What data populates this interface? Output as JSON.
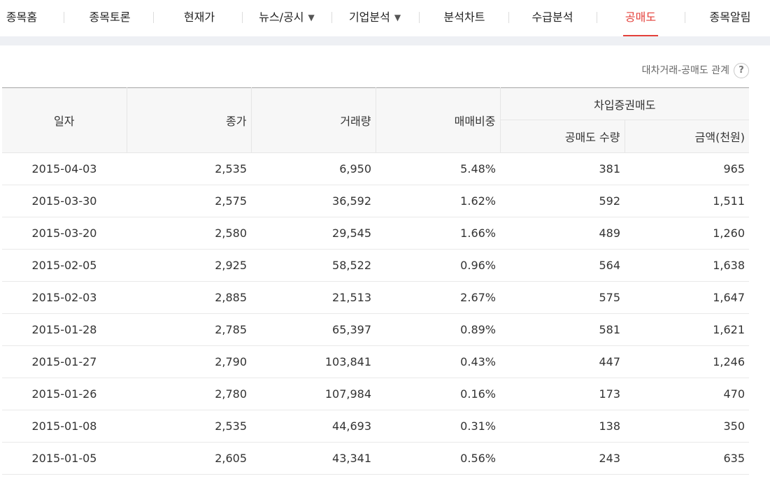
{
  "tabs": [
    {
      "label": "종목홈"
    },
    {
      "label": "종목토론"
    },
    {
      "label": "현재가"
    },
    {
      "label": "뉴스/공시",
      "caret": "▼"
    },
    {
      "label": "기업분석",
      "caret": "▼"
    },
    {
      "label": "분석차트"
    },
    {
      "label": "수급분석"
    },
    {
      "label": "공매도",
      "active": true
    },
    {
      "label": "종목알림"
    }
  ],
  "active_color": "#e4403a",
  "relation_link": {
    "label": "대차거래-공매도 관계",
    "help_glyph": "?"
  },
  "table": {
    "headers": {
      "date": "일자",
      "close": "종가",
      "volume": "거래량",
      "ratio": "매매비중",
      "group": "차입증권매도",
      "short_qty": "공매도 수량",
      "amount": "금액(천원)"
    },
    "rows": [
      {
        "date": "2015-04-03",
        "close": "2,535",
        "volume": "6,950",
        "ratio": "5.48%",
        "qty": "381",
        "amount": "965"
      },
      {
        "date": "2015-03-30",
        "close": "2,575",
        "volume": "36,592",
        "ratio": "1.62%",
        "qty": "592",
        "amount": "1,511"
      },
      {
        "date": "2015-03-20",
        "close": "2,580",
        "volume": "29,545",
        "ratio": "1.66%",
        "qty": "489",
        "amount": "1,260"
      },
      {
        "date": "2015-02-05",
        "close": "2,925",
        "volume": "58,522",
        "ratio": "0.96%",
        "qty": "564",
        "amount": "1,638"
      },
      {
        "date": "2015-02-03",
        "close": "2,885",
        "volume": "21,513",
        "ratio": "2.67%",
        "qty": "575",
        "amount": "1,647"
      },
      {
        "date": "2015-01-28",
        "close": "2,785",
        "volume": "65,397",
        "ratio": "0.89%",
        "qty": "581",
        "amount": "1,621"
      },
      {
        "date": "2015-01-27",
        "close": "2,790",
        "volume": "103,841",
        "ratio": "0.43%",
        "qty": "447",
        "amount": "1,246"
      },
      {
        "date": "2015-01-26",
        "close": "2,780",
        "volume": "107,984",
        "ratio": "0.16%",
        "qty": "173",
        "amount": "470"
      },
      {
        "date": "2015-01-08",
        "close": "2,535",
        "volume": "44,693",
        "ratio": "0.31%",
        "qty": "138",
        "amount": "350"
      },
      {
        "date": "2015-01-05",
        "close": "2,605",
        "volume": "43,341",
        "ratio": "0.56%",
        "qty": "243",
        "amount": "635"
      }
    ]
  }
}
